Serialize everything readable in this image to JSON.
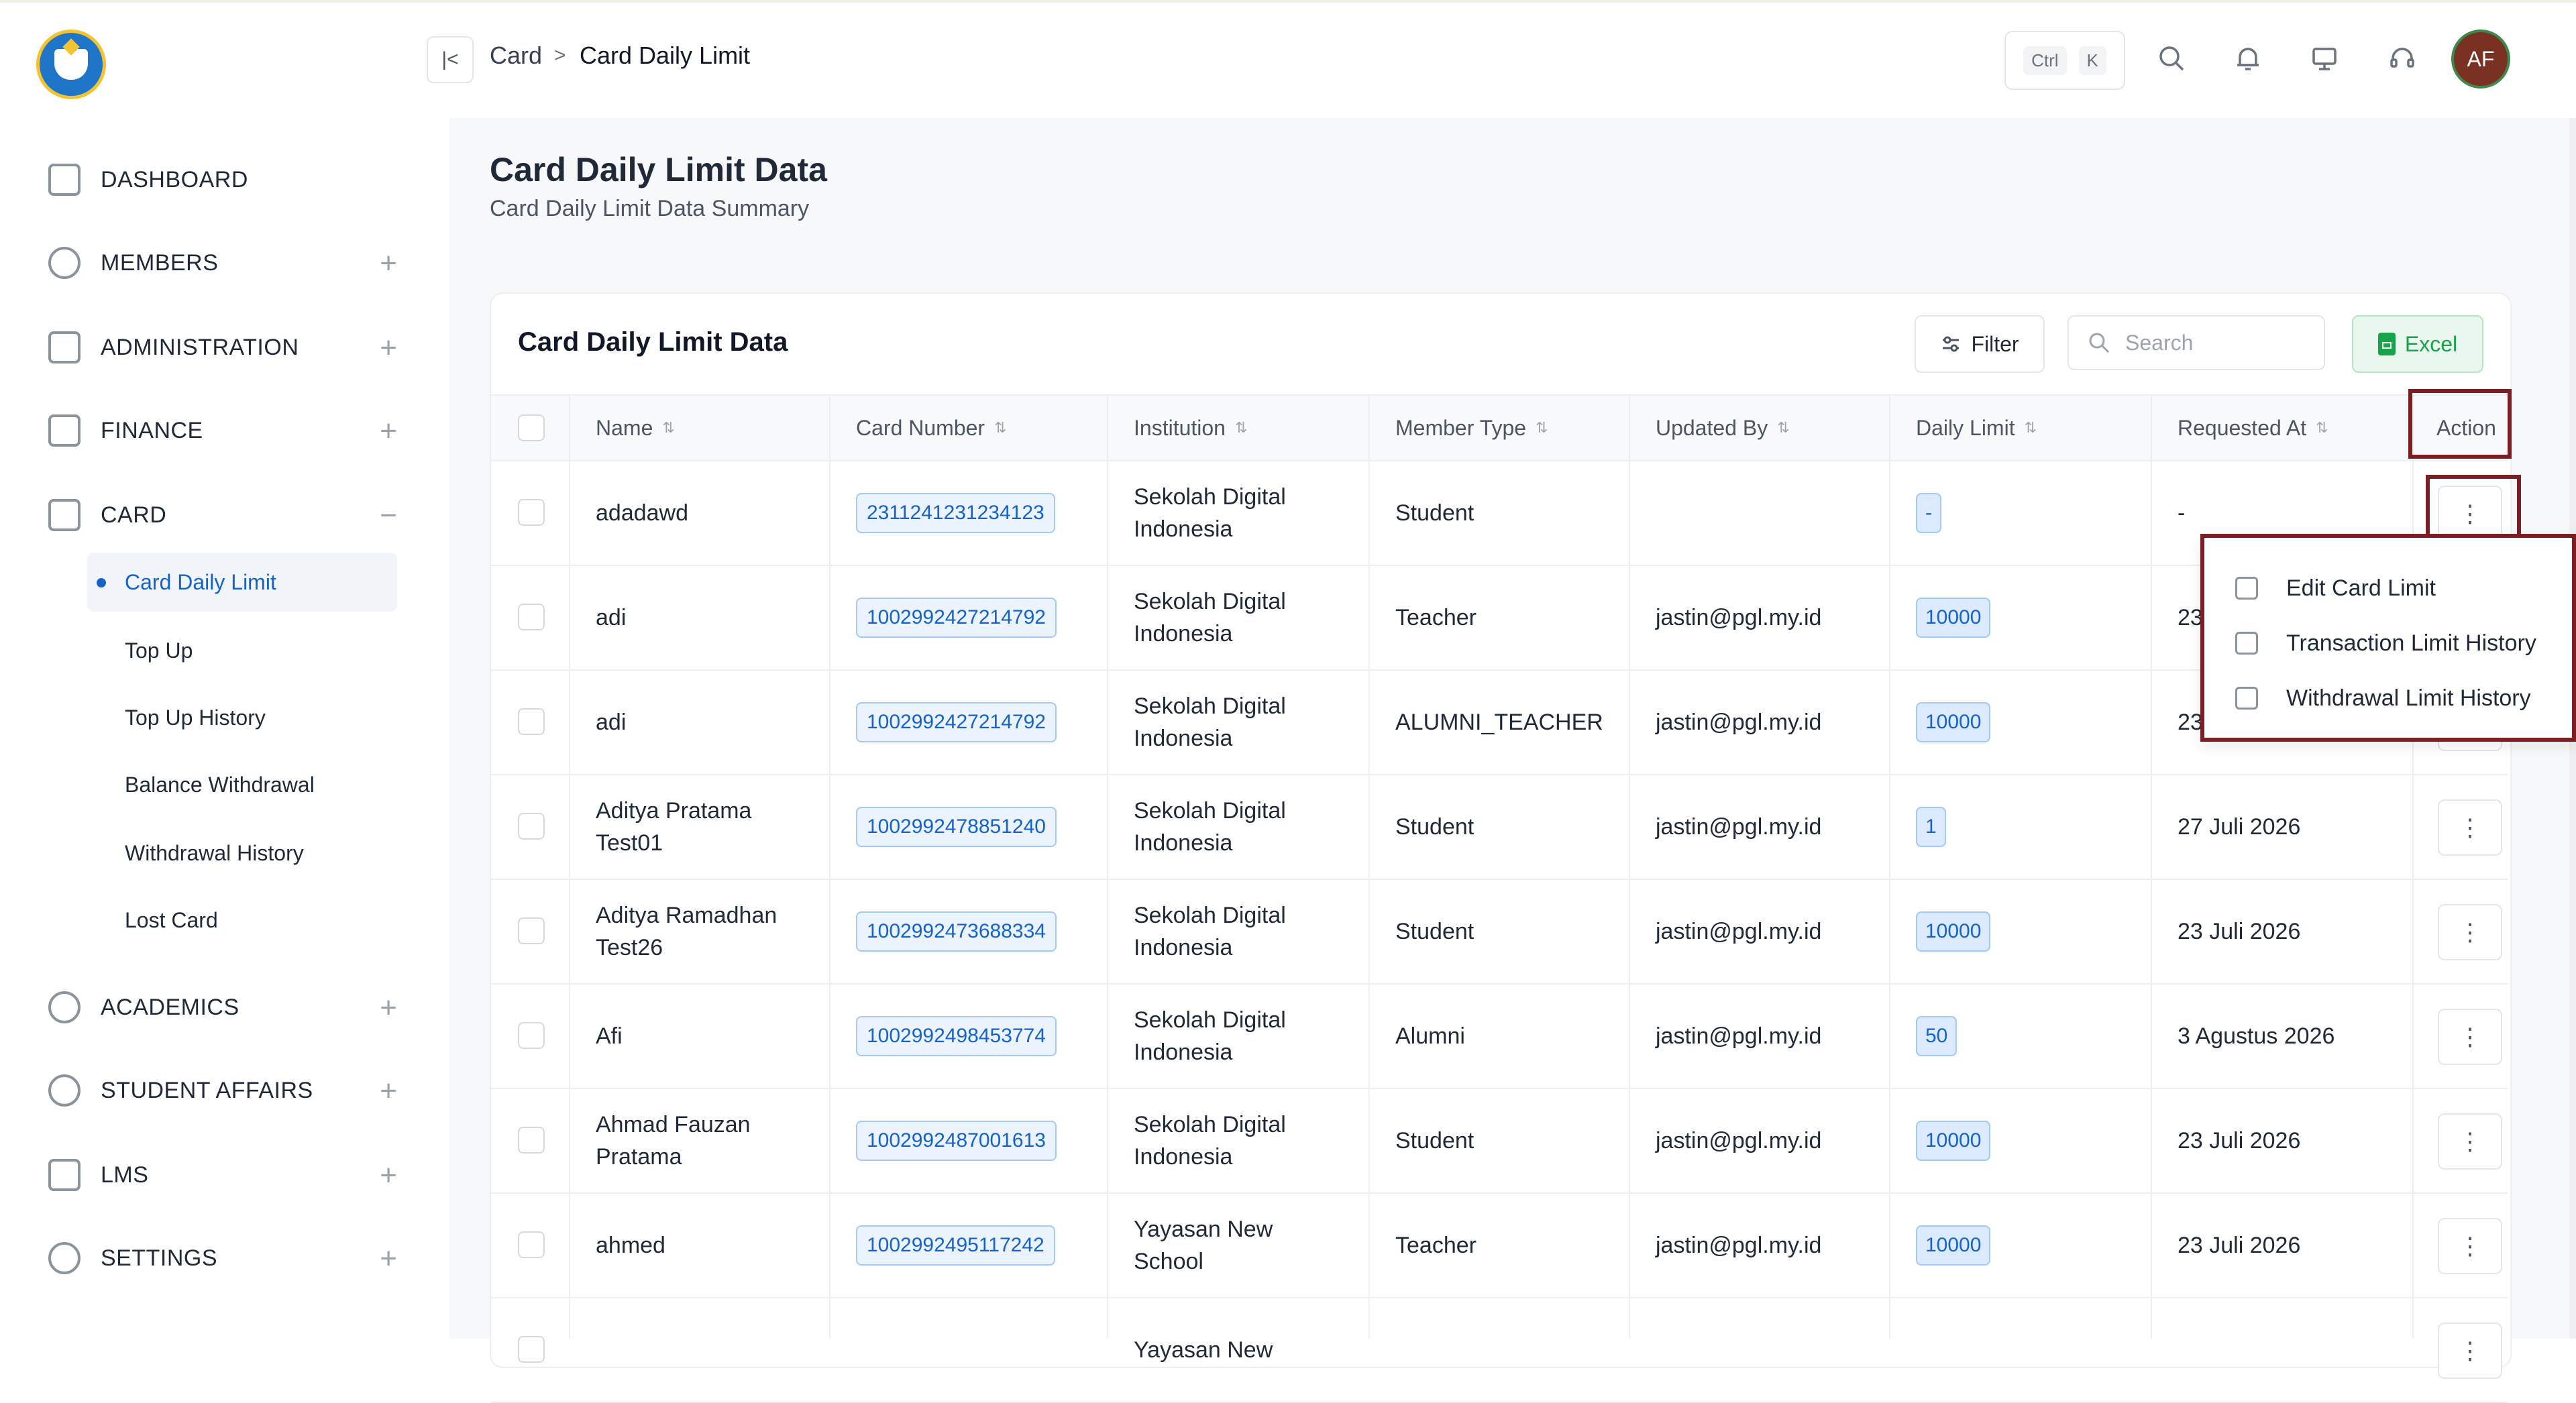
{
  "sidebar": {
    "items": [
      {
        "label": "DASHBOARD",
        "icon": "dashboard-grid-icon",
        "toggle": ""
      },
      {
        "label": "MEMBERS",
        "icon": "users-icon",
        "toggle": "+"
      },
      {
        "label": "ADMINISTRATION",
        "icon": "folder-icon",
        "toggle": "+"
      },
      {
        "label": "FINANCE",
        "icon": "money-icon",
        "toggle": "+"
      },
      {
        "label": "CARD",
        "icon": "card-icon",
        "toggle": "−"
      },
      {
        "label": "ACADEMICS",
        "icon": "academics-icon",
        "toggle": "+"
      },
      {
        "label": "STUDENT AFFAIRS",
        "icon": "student-affairs-icon",
        "toggle": "+"
      },
      {
        "label": "LMS",
        "icon": "lms-icon",
        "toggle": "+"
      },
      {
        "label": "SETTINGS",
        "icon": "gear-icon",
        "toggle": "+"
      }
    ],
    "card_sub": [
      "Card Daily Limit",
      "Top Up",
      "Top Up History",
      "Balance Withdrawal",
      "Withdrawal History",
      "Lost Card"
    ]
  },
  "header": {
    "breadcrumb": [
      "Card",
      "Card Daily Limit"
    ],
    "breadcrumb_sep": ">",
    "kbd": [
      "Ctrl",
      "K"
    ],
    "avatar": "AF"
  },
  "page": {
    "title": "Card Daily Limit Data",
    "subtitle": "Card Daily Limit Data Summary"
  },
  "table_card": {
    "title": "Card Daily Limit Data",
    "filter_label": "Filter",
    "search_placeholder": "Search",
    "excel_label": "Excel"
  },
  "table": {
    "columns": [
      "Name",
      "Card Number",
      "Institution",
      "Member Type",
      "Updated By",
      "Daily Limit",
      "Requested At",
      "Action"
    ],
    "rows": [
      {
        "name": [
          "adadawd"
        ],
        "card": "2311241231234123",
        "inst": [
          "Sekolah Digital",
          "Indonesia"
        ],
        "type": "Student",
        "updated": "",
        "limit": "-",
        "req": "-"
      },
      {
        "name": [
          "adi"
        ],
        "card": "1002992427214792",
        "inst": [
          "Sekolah Digital",
          "Indonesia"
        ],
        "type": "Teacher",
        "updated": "jastin@pgl.my.id",
        "limit": "10000",
        "req": "23"
      },
      {
        "name": [
          "adi"
        ],
        "card": "1002992427214792",
        "inst": [
          "Sekolah Digital",
          "Indonesia"
        ],
        "type": "ALUMNI_TEACHER",
        "updated": "jastin@pgl.my.id",
        "limit": "10000",
        "req": "23"
      },
      {
        "name": [
          "Aditya Pratama",
          "Test01"
        ],
        "card": "1002992478851240",
        "inst": [
          "Sekolah Digital",
          "Indonesia"
        ],
        "type": "Student",
        "updated": "jastin@pgl.my.id",
        "limit": "1",
        "req": "27 Juli 2026"
      },
      {
        "name": [
          "Aditya Ramadhan",
          "Test26"
        ],
        "card": "1002992473688334",
        "inst": [
          "Sekolah Digital",
          "Indonesia"
        ],
        "type": "Student",
        "updated": "jastin@pgl.my.id",
        "limit": "10000",
        "req": "23 Juli 2026"
      },
      {
        "name": [
          "Afi"
        ],
        "card": "1002992498453774",
        "inst": [
          "Sekolah Digital",
          "Indonesia"
        ],
        "type": "Alumni",
        "updated": "jastin@pgl.my.id",
        "limit": "50",
        "req": "3 Agustus 2026"
      },
      {
        "name": [
          "Ahmad Fauzan",
          "Pratama"
        ],
        "card": "1002992487001613",
        "inst": [
          "Sekolah Digital",
          "Indonesia"
        ],
        "type": "Student",
        "updated": "jastin@pgl.my.id",
        "limit": "10000",
        "req": "23 Juli 2026"
      },
      {
        "name": [
          "ahmed"
        ],
        "card": "1002992495117242",
        "inst": [
          "Yayasan New",
          "School"
        ],
        "type": "Teacher",
        "updated": "jastin@pgl.my.id",
        "limit": "10000",
        "req": "23 Juli 2026"
      },
      {
        "name": [
          ""
        ],
        "card": "",
        "inst": [
          "Yayasan New",
          ""
        ],
        "type": "",
        "updated": "",
        "limit": "",
        "req": ""
      }
    ],
    "action_glyph": "⋮"
  },
  "dropdown": {
    "items": [
      "Edit Card Limit",
      "Transaction Limit History",
      "Withdrawal Limit History"
    ]
  },
  "colors": {
    "accent": "#1663c7",
    "highlight": "#7b1f24",
    "excel": "#16a34a",
    "avatar_bg": "#7a3122"
  }
}
